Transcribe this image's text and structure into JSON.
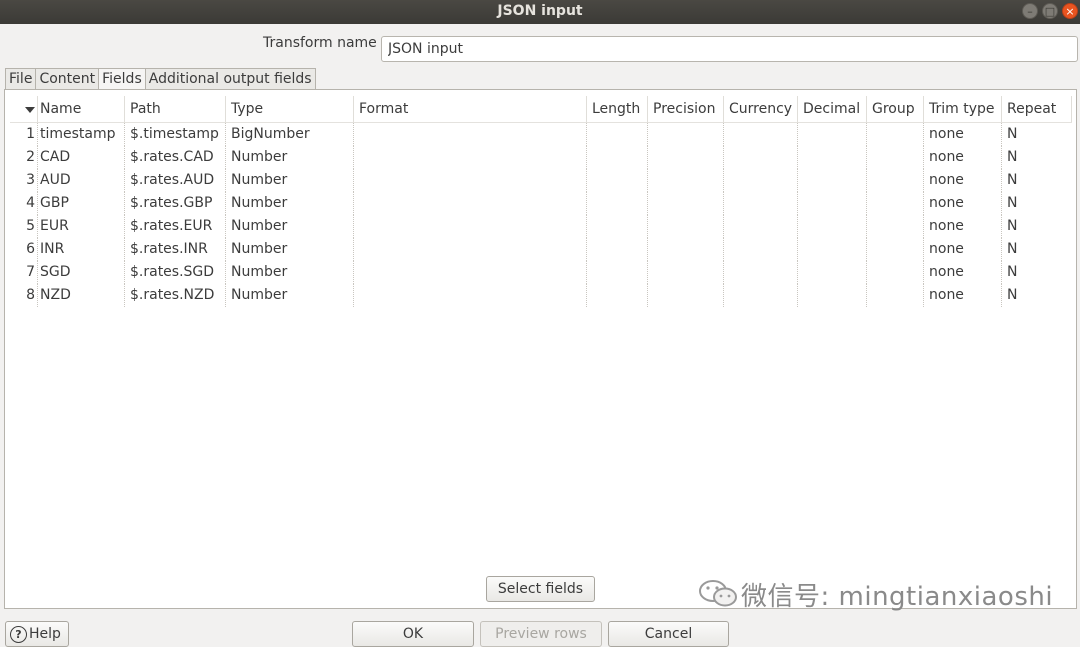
{
  "window": {
    "title": "JSON input"
  },
  "transform": {
    "label": "Transform name",
    "value": "JSON input"
  },
  "tabs": [
    "File",
    "Content",
    "Fields",
    "Additional output fields"
  ],
  "table": {
    "columns": [
      "Name",
      "Path",
      "Type",
      "Format",
      "Length",
      "Precision",
      "Currency",
      "Decimal",
      "Group",
      "Trim type",
      "Repeat"
    ],
    "rows": [
      {
        "n": "1",
        "name": "timestamp",
        "path": "$.timestamp",
        "type": "BigNumber",
        "trim": "none",
        "repeat": "N"
      },
      {
        "n": "2",
        "name": "CAD",
        "path": "$.rates.CAD",
        "type": "Number",
        "trim": "none",
        "repeat": "N"
      },
      {
        "n": "3",
        "name": "AUD",
        "path": "$.rates.AUD",
        "type": "Number",
        "trim": "none",
        "repeat": "N"
      },
      {
        "n": "4",
        "name": "GBP",
        "path": "$.rates.GBP",
        "type": "Number",
        "trim": "none",
        "repeat": "N"
      },
      {
        "n": "5",
        "name": "EUR",
        "path": "$.rates.EUR",
        "type": "Number",
        "trim": "none",
        "repeat": "N"
      },
      {
        "n": "6",
        "name": "INR",
        "path": "$.rates.INR",
        "type": "Number",
        "trim": "none",
        "repeat": "N"
      },
      {
        "n": "7",
        "name": "SGD",
        "path": "$.rates.SGD",
        "type": "Number",
        "trim": "none",
        "repeat": "N"
      },
      {
        "n": "8",
        "name": "NZD",
        "path": "$.rates.NZD",
        "type": "Number",
        "trim": "none",
        "repeat": "N"
      }
    ]
  },
  "buttons": {
    "select_fields": "Select fields",
    "help": "Help",
    "ok": "OK",
    "preview_rows": "Preview rows",
    "cancel": "Cancel"
  },
  "watermark": {
    "text": "微信号: mingtianxiaoshi"
  },
  "icons": {
    "help": "help-circle-icon",
    "sort": "sort-arrow-icon",
    "watermark": "wechat-icon"
  }
}
